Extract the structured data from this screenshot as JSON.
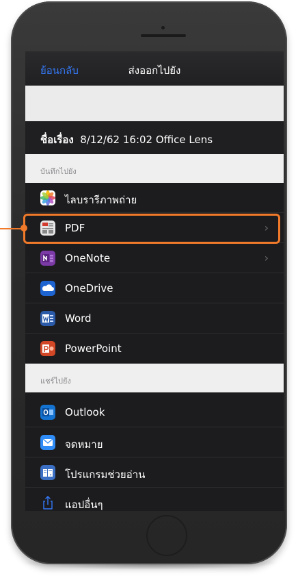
{
  "nav": {
    "back": "ย้อนกลับ",
    "title": "ส่งออกไปยัง"
  },
  "document": {
    "label": "ชื่อเรื่อง",
    "value": "8/12/62 16:02 Office Lens"
  },
  "save_section": {
    "header": "บันทึกไปยัง",
    "items": [
      {
        "label": "ไลบรารีภาพถ่าย",
        "icon": "photos-icon",
        "color": "#ffffff"
      },
      {
        "label": "PDF",
        "icon": "pdf-icon",
        "color": "#d9d9d9",
        "chevron": "›"
      },
      {
        "label": "OneNote",
        "icon": "onenote-icon",
        "color": "#7b3aa6",
        "chevron": "›"
      },
      {
        "label": "OneDrive",
        "icon": "onedrive-icon",
        "color": "#1e64d0"
      },
      {
        "label": "Word",
        "icon": "word-icon",
        "color": "#2b5aa8"
      },
      {
        "label": "PowerPoint",
        "icon": "powerpoint-icon",
        "color": "#d24726"
      }
    ]
  },
  "share_section": {
    "header": "แชร์ไปยัง",
    "items": [
      {
        "label": "Outlook",
        "icon": "outlook-icon",
        "color": "#1472d0"
      },
      {
        "label": "จดหมาย",
        "icon": "mail-icon",
        "color": "#2f8cf7"
      },
      {
        "label": "โปรแกรมช่วยอ่าน",
        "icon": "immersive-reader-icon",
        "color": "#3a6fc4"
      },
      {
        "label": "แอปอื่นๆ",
        "icon": "share-icon",
        "color": "#3478f6"
      }
    ]
  },
  "accent_color": "#f07a2a"
}
